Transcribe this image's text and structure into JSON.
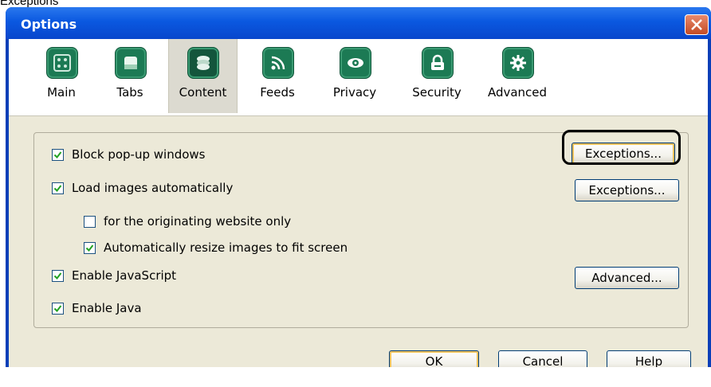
{
  "caption": "Exceptions",
  "window": {
    "title": "Options"
  },
  "toolbar": {
    "tabs": [
      {
        "label": "Main",
        "icon": "main-icon"
      },
      {
        "label": "Tabs",
        "icon": "tabs-icon"
      },
      {
        "label": "Content",
        "icon": "content-icon",
        "active": true
      },
      {
        "label": "Feeds",
        "icon": "feeds-icon"
      },
      {
        "label": "Privacy",
        "icon": "privacy-icon"
      },
      {
        "label": "Security",
        "icon": "lock-icon"
      },
      {
        "label": "Advanced",
        "icon": "gear-icon"
      }
    ]
  },
  "content": {
    "options": [
      {
        "label": "Block pop-up windows",
        "checked": true
      },
      {
        "label": "Load images automatically",
        "checked": true
      },
      {
        "label": "for the originating website only",
        "checked": false
      },
      {
        "label": "Automatically resize images to fit screen",
        "checked": true
      },
      {
        "label": "Enable JavaScript",
        "checked": true
      },
      {
        "label": "Enable Java",
        "checked": true
      }
    ],
    "buttons": {
      "popup_exceptions": "Exceptions...",
      "images_exceptions": "Exceptions...",
      "js_advanced": "Advanced..."
    }
  },
  "footer": {
    "ok": "OK",
    "cancel": "Cancel",
    "help": "Help"
  },
  "colors": {
    "titlebar": "#0a58e0",
    "dialog_bg": "#ece9d8",
    "icon_green": "#1c7a54",
    "highlight": "#000000"
  }
}
